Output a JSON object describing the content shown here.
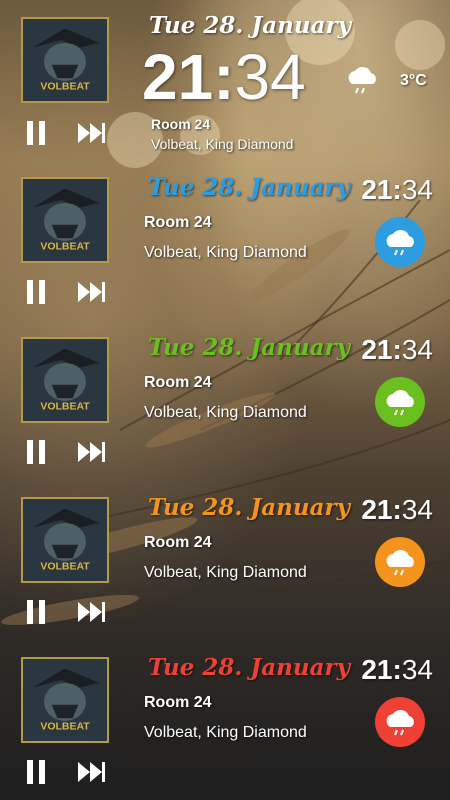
{
  "widgets": [
    {
      "style": "large",
      "date": "Tue 28. January",
      "date_color": "#ffffff",
      "time_hours": "21",
      "time_minutes": "34",
      "song": "Room 24",
      "artist": "Volbeat, King Diamond",
      "temperature": "3°C",
      "weather_icon": "cloud-rain-icon",
      "album_art": "volbeat-album-art"
    },
    {
      "style": "compact",
      "date": "Tue 28. January",
      "date_color": "#2b9de0",
      "time_hours": "21",
      "time_minutes": "34",
      "song": "Room 24",
      "artist": "Volbeat, King Diamond",
      "weather_color": "#2b9de0",
      "weather_icon": "cloud-rain-icon",
      "album_art": "volbeat-album-art"
    },
    {
      "style": "compact",
      "date": "Tue 28. January",
      "date_color": "#6bbf1f",
      "time_hours": "21",
      "time_minutes": "34",
      "song": "Room 24",
      "artist": "Volbeat, King Diamond",
      "weather_color": "#6bbf1f",
      "weather_icon": "cloud-rain-icon",
      "album_art": "volbeat-album-art"
    },
    {
      "style": "compact",
      "date": "Tue 28. January",
      "date_color": "#f5941d",
      "time_hours": "21",
      "time_minutes": "34",
      "song": "Room 24",
      "artist": "Volbeat, King Diamond",
      "weather_color": "#f5941d",
      "weather_icon": "cloud-rain-icon",
      "album_art": "volbeat-album-art"
    },
    {
      "style": "compact",
      "date": "Tue 28. January",
      "date_color": "#ee4034",
      "time_hours": "21",
      "time_minutes": "34",
      "song": "Room 24",
      "artist": "Volbeat, King Diamond",
      "weather_color": "#ee4034",
      "weather_icon": "cloud-rain-icon",
      "album_art": "volbeat-album-art"
    }
  ],
  "controls": {
    "pause_icon": "pause-icon",
    "next_icon": "skip-next-icon"
  }
}
